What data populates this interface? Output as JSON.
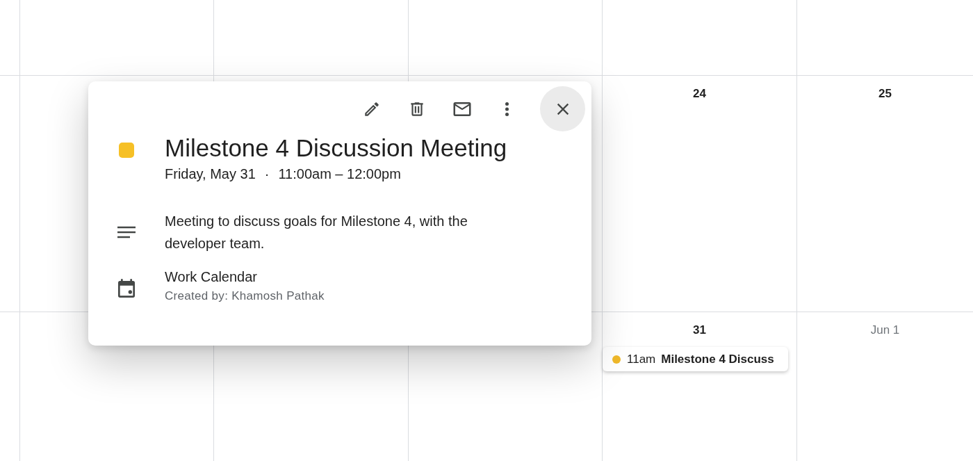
{
  "calendar": {
    "days": [
      {
        "date": "24",
        "muted": false
      },
      {
        "date": "25",
        "muted": false
      },
      {
        "date": "31",
        "muted": false,
        "events": [
          {
            "time": "11am",
            "title": "Milestone 4 Discuss",
            "color": "#f0b92a"
          }
        ]
      },
      {
        "date": "Jun 1",
        "muted": true
      }
    ]
  },
  "popup": {
    "actions": [
      {
        "kind": "edit"
      },
      {
        "kind": "delete"
      },
      {
        "kind": "email"
      },
      {
        "kind": "more"
      }
    ],
    "color": "#f6c026",
    "title": "Milestone 4 Discussion Meeting",
    "when": [
      "Friday, May 31",
      "·",
      "11:00am – 12:00pm"
    ],
    "description": "Meeting to discuss goals for Milestone 4, with the developer team.",
    "calendar": "Work Calendar",
    "created_by": "Created by: Khamosh Pathak"
  }
}
